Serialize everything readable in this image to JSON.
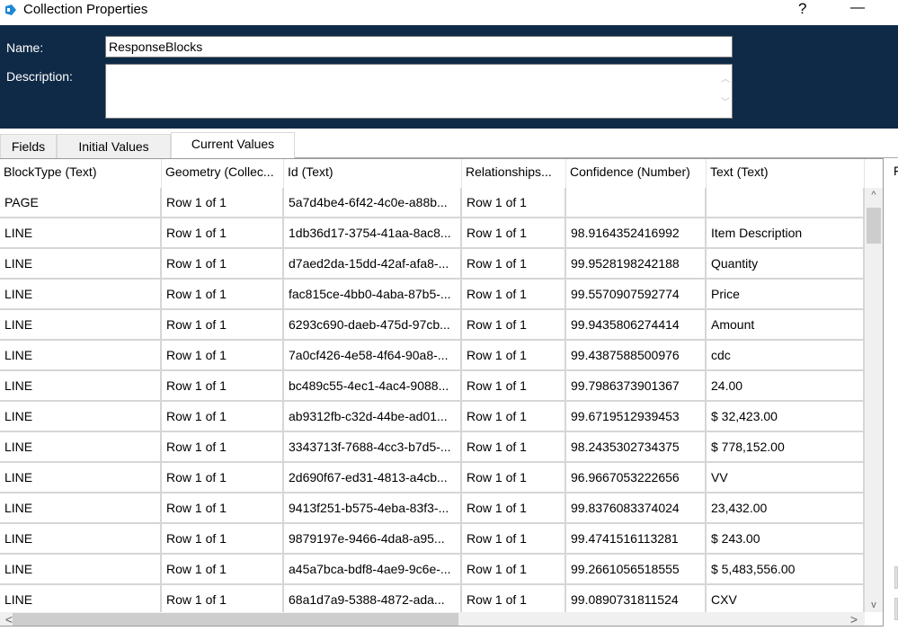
{
  "window": {
    "title": "Collection Properties",
    "help": "?",
    "minimize": "—"
  },
  "form": {
    "name_label": "Name:",
    "name_value": "ResponseBlocks",
    "description_label": "Description:",
    "description_value": ""
  },
  "tabs": [
    {
      "label": "Fields"
    },
    {
      "label": "Initial Values"
    },
    {
      "label": "Current Values",
      "active": true
    }
  ],
  "grid": {
    "columns": [
      "BlockType  (Text)",
      "Geometry  (Collec...",
      "Id  (Text)",
      "Relationships...",
      "Confidence  (Number)",
      "Text  (Text)"
    ],
    "rows": [
      [
        "PAGE",
        "Row 1 of 1",
        "5a7d4be4-6f42-4c0e-a88b...",
        "Row 1 of 1",
        "",
        ""
      ],
      [
        "LINE",
        "Row 1 of 1",
        "1db36d17-3754-41aa-8ac8...",
        "Row 1 of 1",
        "98.9164352416992",
        "Item Description"
      ],
      [
        "LINE",
        "Row 1 of 1",
        "d7aed2da-15dd-42af-afa8-...",
        "Row 1 of 1",
        "99.9528198242188",
        "Quantity"
      ],
      [
        "LINE",
        "Row 1 of 1",
        "fac815ce-4bb0-4aba-87b5-...",
        "Row 1 of 1",
        "99.5570907592774",
        "Price"
      ],
      [
        "LINE",
        "Row 1 of 1",
        "6293c690-daeb-475d-97cb...",
        "Row 1 of 1",
        "99.9435806274414",
        "Amount"
      ],
      [
        "LINE",
        "Row 1 of 1",
        "7a0cf426-4e58-4f64-90a8-...",
        "Row 1 of 1",
        "99.4387588500976",
        "cdc"
      ],
      [
        "LINE",
        "Row 1 of 1",
        "bc489c55-4ec1-4ac4-9088...",
        "Row 1 of 1",
        "99.7986373901367",
        "24.00"
      ],
      [
        "LINE",
        "Row 1 of 1",
        "ab9312fb-c32d-44be-ad01...",
        "Row 1 of 1",
        "99.6719512939453",
        "$ 32,423.00"
      ],
      [
        "LINE",
        "Row 1 of 1",
        "3343713f-7688-4cc3-b7d5-...",
        "Row 1 of 1",
        "98.2435302734375",
        "$ 778,152.00"
      ],
      [
        "LINE",
        "Row 1 of 1",
        "2d690f67-ed31-4813-a4cb...",
        "Row 1 of 1",
        "96.9667053222656",
        "VV"
      ],
      [
        "LINE",
        "Row 1 of 1",
        "9413f251-b575-4eba-83f3-...",
        "Row 1 of 1",
        "99.8376083374024",
        "23,432.00"
      ],
      [
        "LINE",
        "Row 1 of 1",
        "9879197e-9466-4da8-a95...",
        "Row 1 of 1",
        "99.4741516113281",
        "$ 243.00"
      ],
      [
        "LINE",
        "Row 1 of 1",
        "a45a7bca-bdf8-4ae9-9c6e-...",
        "Row 1 of 1",
        "99.2661056518555",
        "$ 5,483,556.00"
      ],
      [
        "LINE",
        "Row 1 of 1",
        "68a1d7a9-5388-4872-ada...",
        "Row 1 of 1",
        "99.0890731811524",
        "CXV"
      ]
    ]
  },
  "side": {
    "clipped_label": "F"
  },
  "colors": {
    "panel": "#0f2a47",
    "accent": "#1e88d6"
  }
}
